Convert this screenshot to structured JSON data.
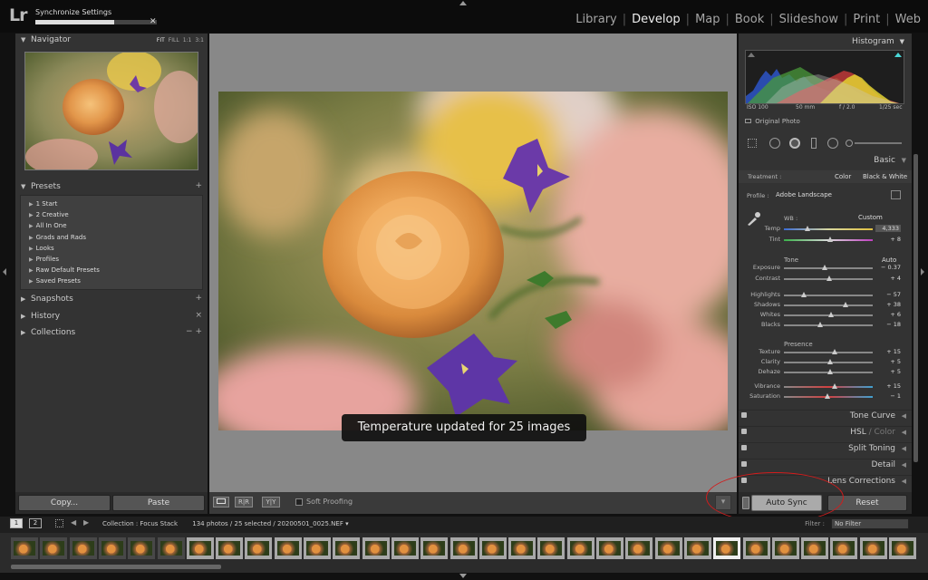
{
  "app": {
    "logo": "Lr",
    "activity_title": "Synchronize Settings",
    "activity_progress": 0.65,
    "activity_close": "✕",
    "modules": [
      "Library",
      "Develop",
      "Map",
      "Book",
      "Slideshow",
      "Print",
      "Web"
    ],
    "active_module": "Develop"
  },
  "left": {
    "navigator": {
      "title": "Navigator",
      "modes": [
        "FIT",
        "FILL",
        "1:1",
        "3:1"
      ]
    },
    "presets": {
      "title": "Presets",
      "action": "+",
      "items": [
        "1 Start",
        "2 Creative",
        "All In One",
        "Grads and Rads",
        "Looks",
        "Profiles",
        "Raw Default Presets",
        "Saved Presets"
      ]
    },
    "snapshots": {
      "title": "Snapshots",
      "action": "+"
    },
    "history": {
      "title": "History",
      "action": "×"
    },
    "collections": {
      "title": "Collections",
      "action": "− +"
    },
    "copy_label": "Copy...",
    "paste_label": "Paste"
  },
  "center": {
    "toast": "Temperature updated for 25 images",
    "soft_proofing": "Soft Proofing",
    "view_buttons": [
      "R|R",
      "Y|Y"
    ]
  },
  "right": {
    "histogram_title": "Histogram",
    "exif": {
      "iso": "ISO 100",
      "focal": "50 mm",
      "aperture": "f / 2.0",
      "shutter": "1/25 sec"
    },
    "original_photo": "Original Photo",
    "basic": {
      "title": "Basic",
      "treatment_label": "Treatment :",
      "treatment_color": "Color",
      "treatment_bw": "Black & White",
      "profile_label": "Profile :",
      "profile_value": "Adobe Landscape",
      "wb_label": "WB :",
      "wb_value": "Custom",
      "tone_label": "Tone",
      "tone_auto": "Auto",
      "presence_label": "Presence",
      "sliders": [
        {
          "name": "Temp",
          "value": "4,333",
          "pos": 0.27
        },
        {
          "name": "Tint",
          "value": "+ 8",
          "pos": 0.52
        },
        {
          "name": "Exposure",
          "value": "− 0.37",
          "pos": 0.46
        },
        {
          "name": "Contrast",
          "value": "+ 4",
          "pos": 0.51
        },
        {
          "name": "Highlights",
          "value": "− 57",
          "pos": 0.22
        },
        {
          "name": "Shadows",
          "value": "+ 38",
          "pos": 0.69
        },
        {
          "name": "Whites",
          "value": "+ 6",
          "pos": 0.53
        },
        {
          "name": "Blacks",
          "value": "− 18",
          "pos": 0.41
        },
        {
          "name": "Texture",
          "value": "+ 15",
          "pos": 0.57
        },
        {
          "name": "Clarity",
          "value": "+ 5",
          "pos": 0.52
        },
        {
          "name": "Dehaze",
          "value": "+ 5",
          "pos": 0.52
        },
        {
          "name": "Vibrance",
          "value": "+ 15",
          "pos": 0.57
        },
        {
          "name": "Saturation",
          "value": "− 1",
          "pos": 0.49
        }
      ]
    },
    "sections": [
      {
        "name": "Tone Curve",
        "dim": ""
      },
      {
        "name": "HSL",
        "dim": " / Color"
      },
      {
        "name": "Split Toning",
        "dim": ""
      },
      {
        "name": "Detail",
        "dim": ""
      },
      {
        "name": "Lens Corrections",
        "dim": ""
      }
    ],
    "auto_sync": "Auto Sync",
    "reset": "Reset"
  },
  "filmstrip": {
    "page1": "1",
    "page2": "2",
    "collection": "Collection : Focus Stack",
    "count": "134 photos / 25 selected / 20200501_0025.NEF ▾",
    "filter_label": "Filter :",
    "filter_value": "No Filter",
    "thumbs_total": 31,
    "selected_count": 25,
    "current_index": 24
  },
  "colors": {
    "accent_red": "#d21c1c",
    "panel": "#333333",
    "canvas": "#888888"
  }
}
